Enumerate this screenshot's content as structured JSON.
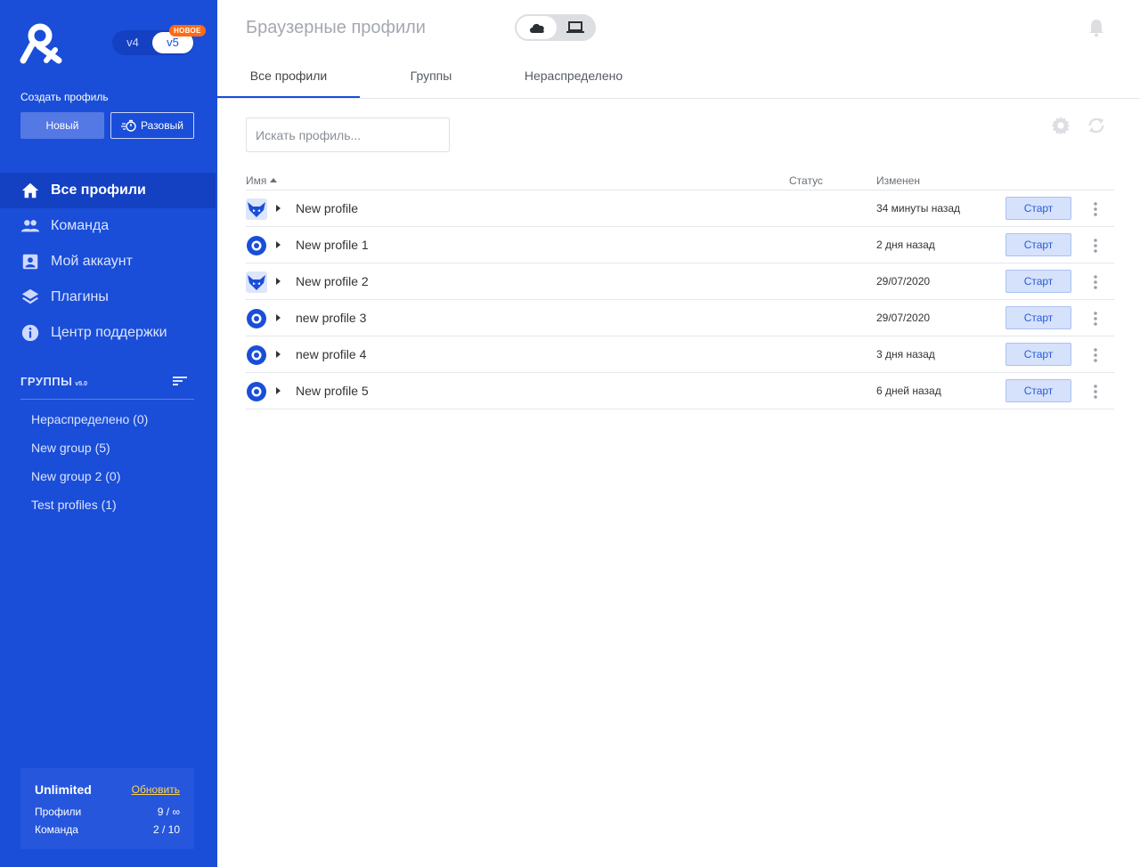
{
  "sidebar": {
    "version_toggle": {
      "v4": "v4",
      "v5": "v5",
      "badge": "НОВОЕ"
    },
    "create_profile_label": "Создать профиль",
    "btn_new": "Новый",
    "btn_once": "Разовый",
    "nav": [
      {
        "label": "Все профили",
        "icon": "home-icon",
        "active": true
      },
      {
        "label": "Команда",
        "icon": "team-icon",
        "active": false
      },
      {
        "label": "Мой аккаунт",
        "icon": "account-icon",
        "active": false
      },
      {
        "label": "Плагины",
        "icon": "layers-icon",
        "active": false
      },
      {
        "label": "Центр поддержки",
        "icon": "info-icon",
        "active": false
      }
    ],
    "groups_title": "ГРУППЫ",
    "groups_version": "v5.0",
    "groups": [
      {
        "label": "Нераспределено  (0)"
      },
      {
        "label": "New group  (5)"
      },
      {
        "label": "New group 2  (0)"
      },
      {
        "label": "Test profiles  (1)"
      }
    ],
    "plan": {
      "name": "Unlimited",
      "upgrade": "Обновить",
      "profiles_label": "Профили",
      "profiles_value": "9 / ∞",
      "team_label": "Команда",
      "team_value": "2 / 10"
    }
  },
  "header": {
    "title": "Браузерные профили",
    "mode_cloud_icon": "cloud-icon",
    "mode_local_icon": "laptop-icon"
  },
  "tabs": [
    {
      "label": "Все профили",
      "active": true
    },
    {
      "label": "Группы",
      "active": false
    },
    {
      "label": "Нераспределено",
      "active": false
    }
  ],
  "search": {
    "placeholder": "Искать профиль..."
  },
  "table": {
    "columns": {
      "name": "Имя",
      "status": "Статус",
      "changed": "Изменен"
    },
    "start_label": "Старт",
    "rows": [
      {
        "browser": "fox",
        "name": "New profile",
        "status": "",
        "changed": "34 минуты назад"
      },
      {
        "browser": "orbita",
        "name": "New profile 1",
        "status": "",
        "changed": "2 дня назад"
      },
      {
        "browser": "fox",
        "name": "New profile 2",
        "status": "",
        "changed": "29/07/2020"
      },
      {
        "browser": "orbita",
        "name": "new profile 3",
        "status": "",
        "changed": "29/07/2020"
      },
      {
        "browser": "orbita",
        "name": "new profile 4",
        "status": "",
        "changed": "3 дня назад"
      },
      {
        "browser": "orbita",
        "name": "New profile 5",
        "status": "",
        "changed": "6 дней назад"
      }
    ]
  },
  "colors": {
    "sidebar_bg": "#1a4ed8",
    "accent": "#1a4ed8",
    "badge": "#ff6a13",
    "start_bg": "#d6e2fb"
  }
}
